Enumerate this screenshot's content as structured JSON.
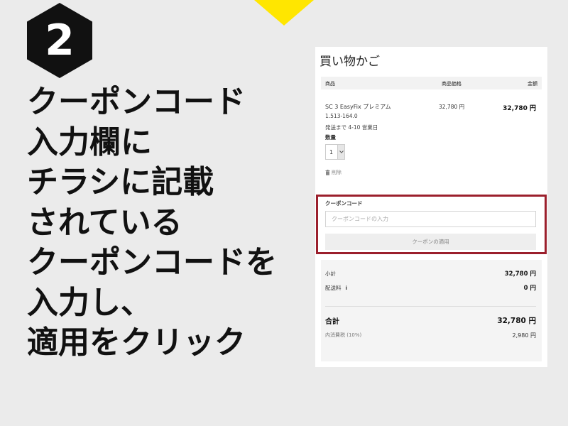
{
  "colors": {
    "background": "#ebebeb",
    "accent_yellow": "#ffe600",
    "badge_black": "#111111",
    "highlight_red": "#9b1f2c"
  },
  "step": {
    "number": "2"
  },
  "instruction": {
    "lines": [
      "クーポンコード",
      "入力欄に",
      "チラシに記載",
      "されている",
      "クーポンコードを",
      "入力し、",
      "適用をクリック"
    ]
  },
  "cart": {
    "title": "買い物かご",
    "table_headers": {
      "product": "商品",
      "price": "商品価格",
      "amount": "金額"
    },
    "item": {
      "name": "SC 3 EasyFix プレミアム",
      "code": "1.513-164.0",
      "shipping": "発送まで 4-10 営業日",
      "price": "32,780 円",
      "amount": "32,780 円",
      "quantity_label": "数量",
      "quantity_value": "1",
      "delete_label": "削除"
    },
    "coupon": {
      "label": "クーポンコード",
      "placeholder": "クーポンコードの入力",
      "value": "",
      "apply_button": "クーポンの適用"
    },
    "summary": {
      "subtotal_label": "小計",
      "subtotal_value": "32,780 円",
      "shipping_label": "配送料",
      "shipping_info": "i",
      "shipping_value": "0 円",
      "total_label": "合計",
      "total_value": "32,780 円",
      "tax_label": "内消費税 (10%)",
      "tax_value": "2,980 円"
    }
  }
}
